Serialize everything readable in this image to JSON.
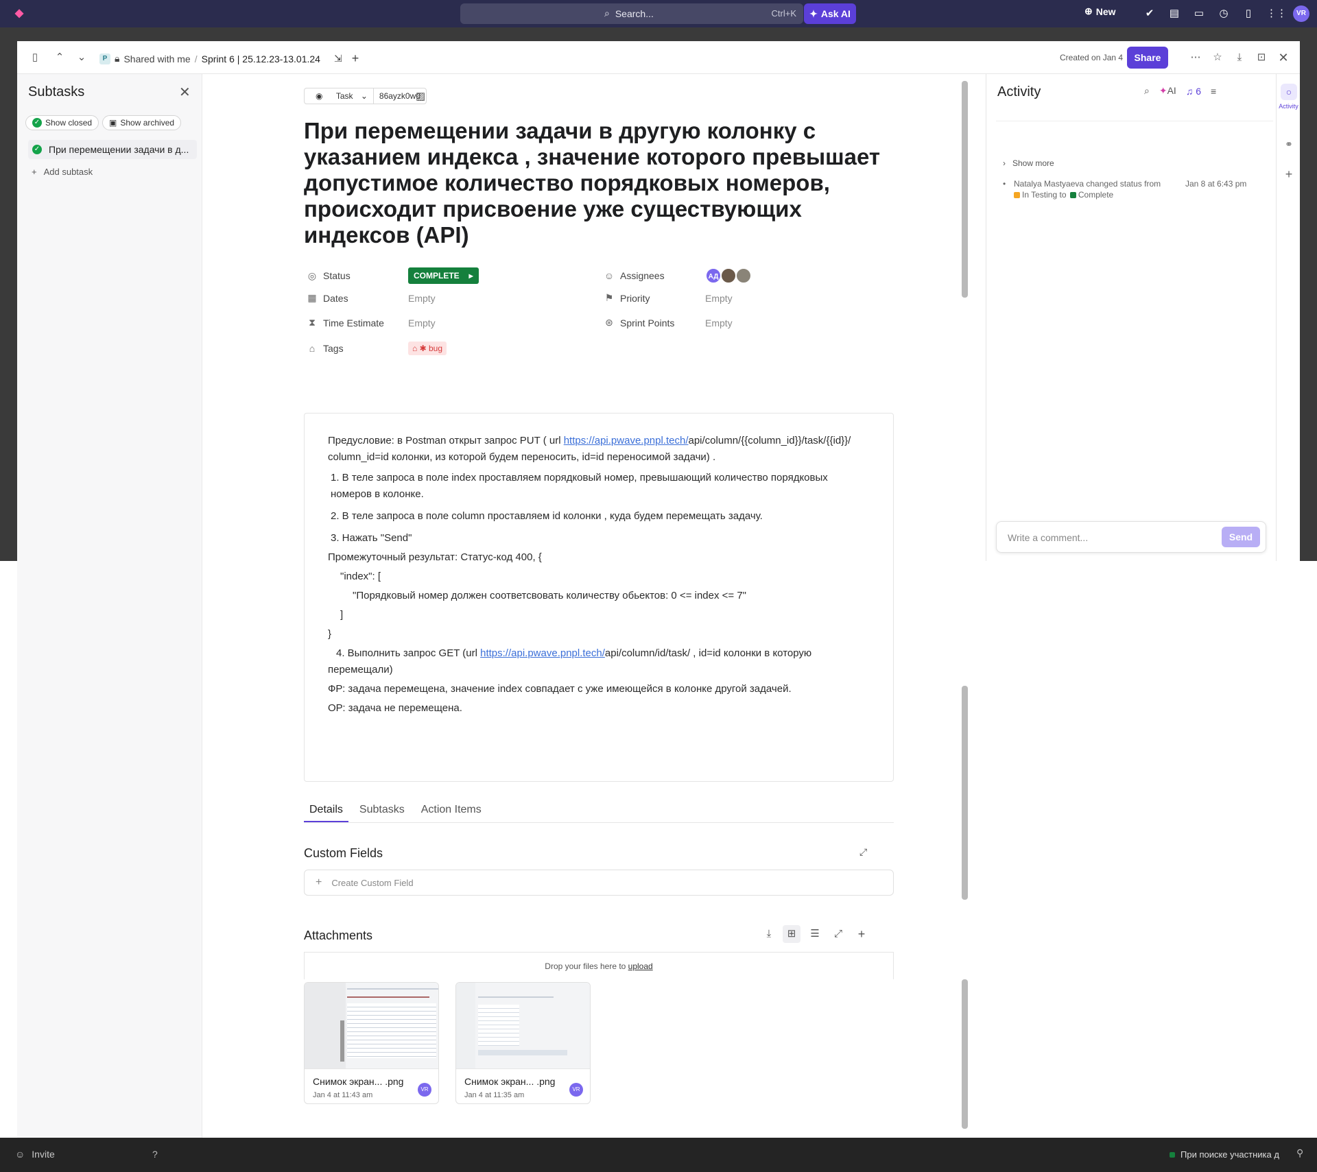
{
  "topbar": {
    "search_placeholder": "Search...",
    "search_shortcut": "Ctrl+K",
    "ask_ai": "Ask AI",
    "new_label": "New",
    "user_initials": "VR"
  },
  "header": {
    "breadcrumb_space_badge": "P",
    "breadcrumb_shared": "Shared with me",
    "breadcrumb_sep": "/",
    "breadcrumb_list": "Sprint 6 | 25.12.23-13.01.24",
    "created": "Created on Jan 4",
    "share": "Share"
  },
  "subtasks": {
    "title": "Subtasks",
    "show_closed": "Show closed",
    "show_archived": "Show archived",
    "items": [
      {
        "label": "При перемещении задачи в д..."
      }
    ],
    "add_subtask": "Add subtask"
  },
  "task": {
    "type": "Task",
    "id": "86ayzk0w0",
    "title": "При перемещении задачи в другую колонку с указанием индекса , значение которого превышает допустимое количество порядковых номеров, происходит присвоение уже существующих индексов (API)",
    "fields": {
      "status_label": "Status",
      "status_value": "COMPLETE",
      "dates_label": "Dates",
      "dates_value": "Empty",
      "time_label": "Time Estimate",
      "time_value": "Empty",
      "tags_label": "Tags",
      "tag_value": "bug",
      "assignees_label": "Assignees",
      "assignee_initials": "АД",
      "priority_label": "Priority",
      "priority_value": "Empty",
      "sprint_label": "Sprint Points",
      "sprint_value": "Empty"
    },
    "description": {
      "pre_text": "Предусловие:  в Postman открыт запрос PUT ( url ",
      "pre_link": "https://api.pwave.pnpl.tech/",
      "pre_rest": "api/column/{{column_id}}/task/{{id}}/  column_id=id колонки, из которой будем переносить, id=id переносимой задачи) .",
      "step1": "1.  В теле запроса в поле index проставляем порядковый номер, превышающий количество порядковых номеров в колонке.",
      "step2": "2.  В теле запроса в поле column проставляем id колонки , куда будем перемещать задачу.",
      "step3": "3.  Нажать \"Send\"",
      "intermediate": "Промежуточный результат: Статус-код 400, {",
      "json1": "\"index\": [",
      "json2": "\"Порядковый номер должен соответсвовать количеству обьектов: 0 <= index <= 7\"",
      "json3": "]",
      "json4": "}",
      "step4_pre": "4.   Выполнить запрос GET (url ",
      "step4_link": "https://api.pwave.pnpl.tech/",
      "step4_rest": "api/column/id/task/ , id=id колонки в которую перемещали)",
      "fr": "ФР: задача перемещена, значение  index совпадает с уже имеющейся в колонке другой задачей.",
      "or": "ОР: задача не перемещена."
    },
    "tabs": [
      "Details",
      "Subtasks",
      "Action Items"
    ],
    "custom_fields_title": "Custom Fields",
    "create_custom_field": "Create Custom Field",
    "attachments_title": "Attachments",
    "drop_text": "Drop your files here to ",
    "drop_link": "upload",
    "attachments": [
      {
        "name": "Снимок экран...  .png",
        "time": "Jan 4 at 11:43 am",
        "user": "VR"
      },
      {
        "name": "Снимок экран...  .png",
        "time": "Jan 4 at 11:35 am",
        "user": "VR"
      }
    ]
  },
  "activity": {
    "title": "Activity",
    "ai": "AI",
    "notif_count": "6",
    "show_more": "Show more",
    "event_text": "Natalya Mastyaeva changed status from",
    "event_from": "In Testing",
    "event_to_word": "to",
    "event_to": "Complete",
    "event_time": "Jan 8 at 6:43 pm",
    "comment_placeholder": "Write a comment...",
    "send": "Send",
    "rail_label": "Activity"
  },
  "bottom": {
    "invite": "Invite",
    "task_chip": "При поиске участника д"
  },
  "colors": {
    "accent": "#5b3fd8",
    "complete": "#15803d",
    "in_testing": "#f5a623",
    "tag_bg": "#fde3e3"
  }
}
